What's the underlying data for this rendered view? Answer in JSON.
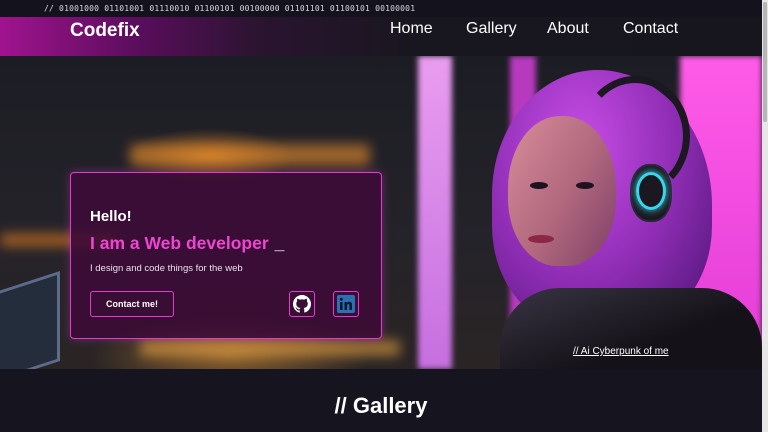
{
  "binary_banner": "// 01001000 01101001 01110010 01100101 00100000 01101101 01100101 00100001",
  "nav": {
    "brand": "Codefix",
    "links": [
      {
        "label": "Home"
      },
      {
        "label": "Gallery"
      },
      {
        "label": "About"
      },
      {
        "label": "Contact"
      }
    ]
  },
  "hero": {
    "greeting": "Hello!",
    "headline": "I am a Web developer",
    "cursor": "_",
    "tagline": "I design and code things for the web",
    "contact_button": "Contact me!",
    "social": [
      {
        "name": "github",
        "icon": "github-icon"
      },
      {
        "name": "linkedin",
        "icon": "linkedin-icon"
      }
    ],
    "image_caption": "// Ai Cyberpunk of me"
  },
  "gallery": {
    "title": "// Gallery"
  },
  "colors": {
    "accent": "#e43ad4",
    "headline": "#ef45d2",
    "background": "#15141f",
    "nav_gradient_start": "#a0138f"
  }
}
